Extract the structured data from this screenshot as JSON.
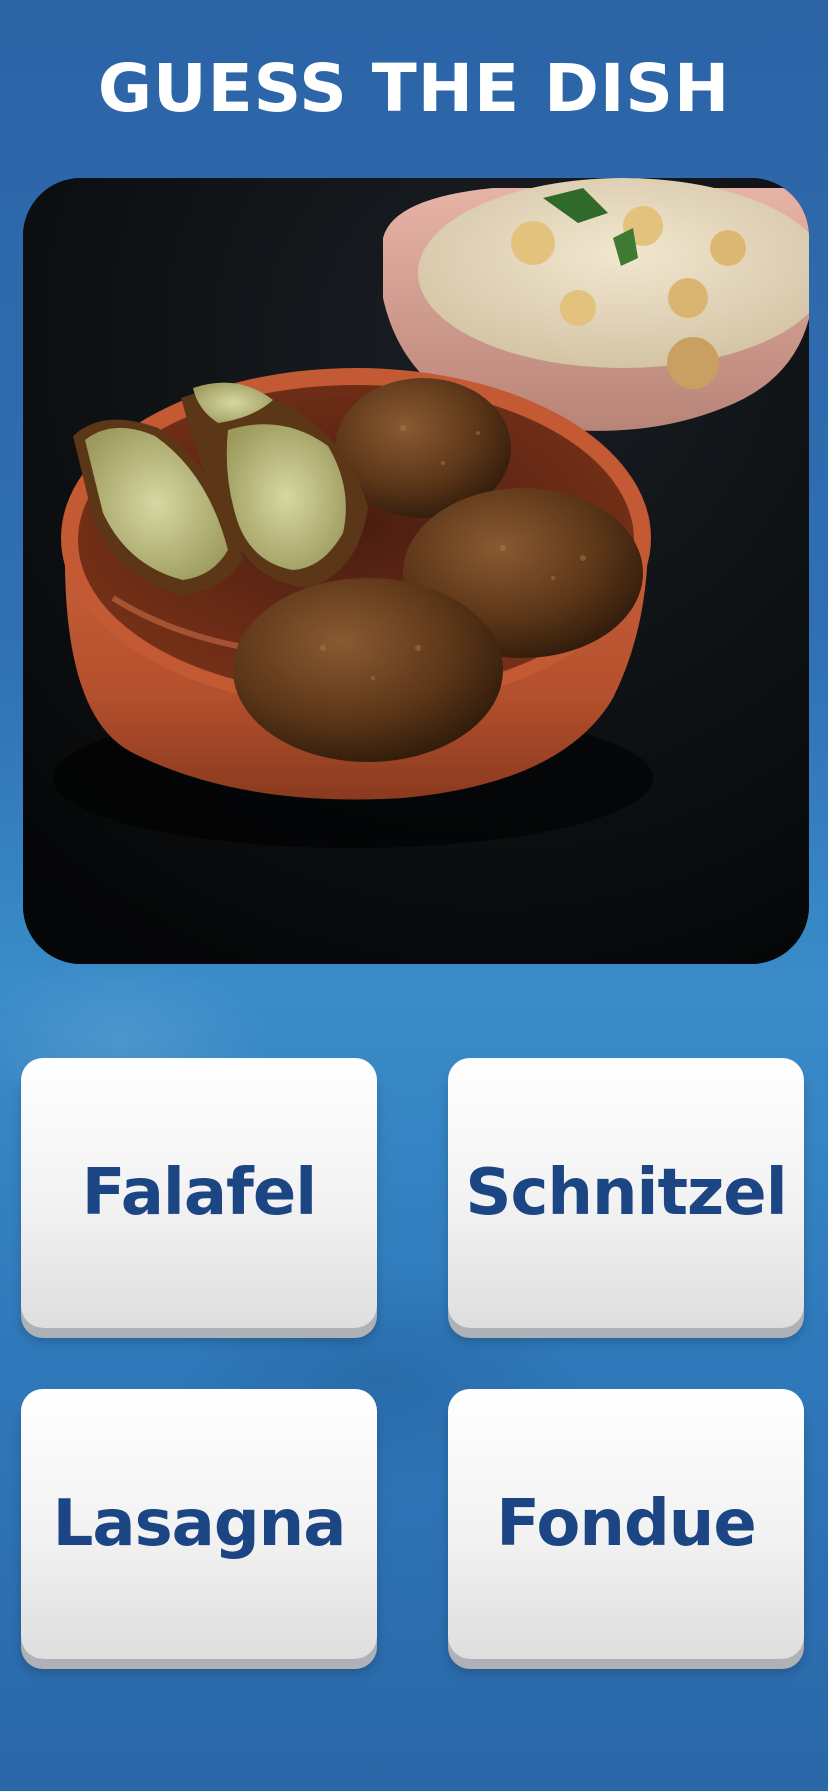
{
  "header": {
    "title": "GUESS THE DISH"
  },
  "question": {
    "image": {
      "subject": "falafel-in-clay-bowl-with-hummus",
      "alt": ""
    }
  },
  "answers": [
    {
      "label": "Falafel"
    },
    {
      "label": "Schnitzel"
    },
    {
      "label": "Lasagna"
    },
    {
      "label": "Fondue"
    }
  ],
  "colors": {
    "background": "#2f6fb2",
    "button_text": "#1b4583",
    "button_face": "#f2f2f2",
    "title_text": "#ffffff"
  }
}
